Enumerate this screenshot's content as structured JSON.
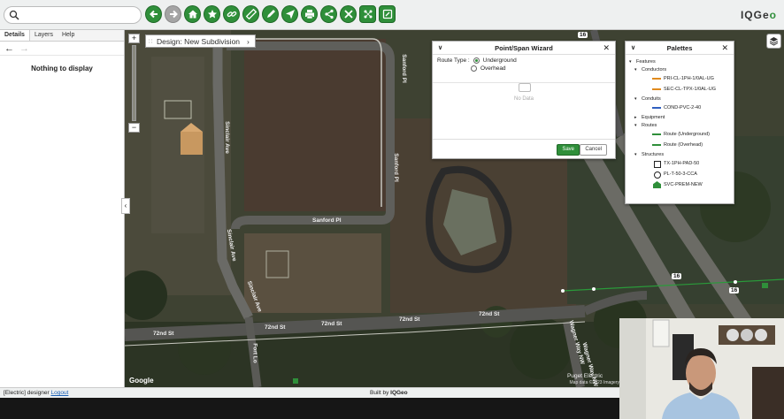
{
  "search": {
    "placeholder": ""
  },
  "toolbar": {
    "tools": [
      "back-icon",
      "forward-icon",
      "home-icon",
      "star-icon",
      "link-icon",
      "ruler-icon",
      "pen-icon",
      "locate-icon",
      "print-icon",
      "share-icon",
      "tools-icon",
      "network-icon",
      "design-icon"
    ],
    "accent": "#2f8f3a"
  },
  "logo": {
    "part1": "IQGe",
    "part2": "o"
  },
  "left_panel": {
    "tabs": [
      "Details",
      "Layers",
      "Help"
    ],
    "empty_message": "Nothing to display"
  },
  "map": {
    "design_title": "Design: New Subdivision",
    "street_labels": [
      "Sanford Pl",
      "Sanford Pl",
      "Sanford Pl",
      "Sinclair Ave",
      "Sinclair Ave",
      "Sinclair Ave",
      "72nd St",
      "72nd St",
      "72nd St",
      "72nd St",
      "72nd St",
      "Fort Lo",
      "Wagner Way NW",
      "Wagner Way NW"
    ],
    "highway_badges": [
      "16",
      "16",
      "16"
    ],
    "google": "Google",
    "attribution": "Map data ©2023 Imagery",
    "trailer": "Puget Electric"
  },
  "wizard": {
    "title": "Point/Span Wizard",
    "route_type_label": "Route Type :",
    "options": [
      "Underground",
      "Overhead"
    ],
    "selected": "Underground",
    "no_data": "No Data",
    "save": "Save",
    "cancel": "Cancel"
  },
  "palettes": {
    "title": "Palettes",
    "root": "Features",
    "groups": [
      {
        "name": "Conductors",
        "items": [
          {
            "label": "PRI-CL-1PH-1/0AL-UG",
            "symbol": "line",
            "color": "#e08a1e"
          },
          {
            "label": "SEC-CL-TPX-1/0AL-UG",
            "symbol": "line",
            "color": "#e08a1e"
          }
        ]
      },
      {
        "name": "Conduits",
        "items": [
          {
            "label": "COND-PVC-2-40",
            "symbol": "dash",
            "color": "#3060c0"
          }
        ]
      },
      {
        "name": "Equipment",
        "items": []
      },
      {
        "name": "Routes",
        "items": [
          {
            "label": "Route (Underground)",
            "symbol": "line",
            "color": "#2f8f3a"
          },
          {
            "label": "Route (Overhead)",
            "symbol": "line",
            "color": "#2f8f3a"
          }
        ]
      },
      {
        "name": "Structures",
        "items": [
          {
            "label": "TX-1PH-PAD-50",
            "symbol": "box",
            "color": "#222222"
          },
          {
            "label": "PL-T-50-3-CCA",
            "symbol": "circ",
            "color": "#222222"
          },
          {
            "label": "SVC-PREM-NEW",
            "symbol": "house",
            "color": "#2f8f3a"
          }
        ]
      }
    ]
  },
  "status_bar": {
    "user": "[Electric] designer",
    "logout": "Logout",
    "built_by": "Built by",
    "built_brand": "IQGeo"
  }
}
